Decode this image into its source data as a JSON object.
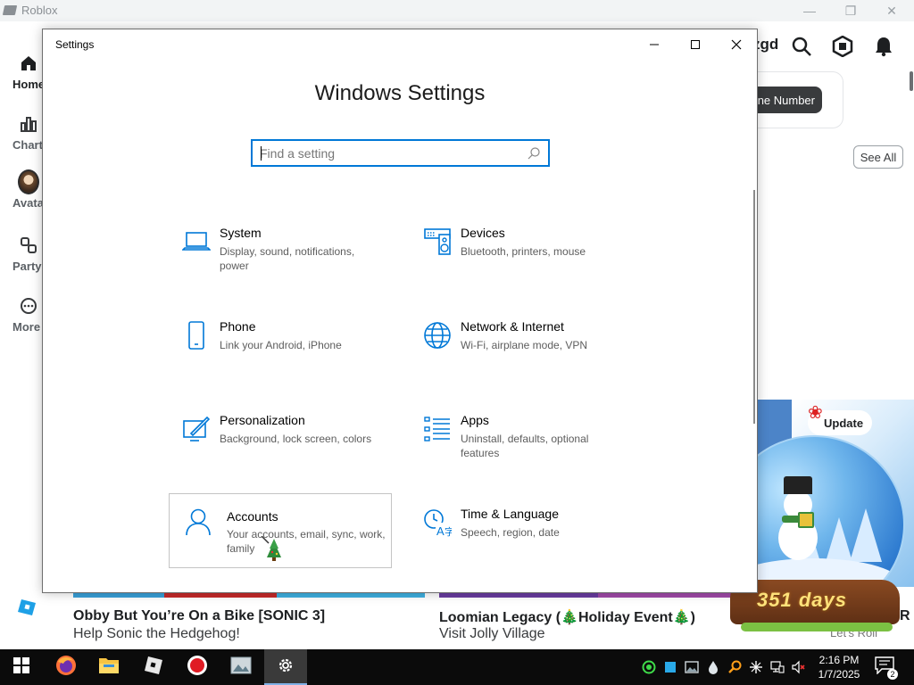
{
  "roblox": {
    "window_title": "Roblox",
    "nav": [
      {
        "label": "Home",
        "icon": "home-icon"
      },
      {
        "label": "Charts",
        "icon": "charts-icon"
      },
      {
        "label": "Avata",
        "icon": "avatar-icon"
      },
      {
        "label": "Party",
        "icon": "party-icon"
      },
      {
        "label": "More",
        "icon": "more-icon"
      }
    ],
    "username_fragment": "zgd",
    "phone_button": "ne Number",
    "see_all": "See All",
    "update_badge": "Update",
    "games": [
      {
        "title": "Obby But You’re On a Bike [SONIC 3]",
        "subtitle": "Help Sonic the Hedgehog!"
      },
      {
        "title": "Loomian Legacy (🎄Holiday Event🎄)",
        "subtitle": "Visit Jolly Village"
      },
      {
        "title": "R",
        "subtitle": "Let's Roll"
      }
    ],
    "countdown": "351 days",
    "colors": {
      "accent_blue": "#0078d7",
      "dark_button": "#393b3d"
    }
  },
  "settings": {
    "window_title": "Settings",
    "heading": "Windows Settings",
    "search_placeholder": "Find a setting",
    "tiles": [
      {
        "name": "System",
        "desc": "Display, sound, notifications, power",
        "icon": "laptop-icon"
      },
      {
        "name": "Devices",
        "desc": "Bluetooth, printers, mouse",
        "icon": "devices-icon"
      },
      {
        "name": "Phone",
        "desc": "Link your Android, iPhone",
        "icon": "phone-icon"
      },
      {
        "name": "Network & Internet",
        "desc": "Wi-Fi, airplane mode, VPN",
        "icon": "globe-icon"
      },
      {
        "name": "Personalization",
        "desc": "Background, lock screen, colors",
        "icon": "paintbrush-icon"
      },
      {
        "name": "Apps",
        "desc": "Uninstall, defaults, optional features",
        "icon": "apps-list-icon"
      },
      {
        "name": "Accounts",
        "desc": "Your accounts, email, sync, work, family",
        "icon": "person-icon"
      },
      {
        "name": "Time & Language",
        "desc": "Speech, region, date",
        "icon": "time-language-icon"
      }
    ]
  },
  "taskbar": {
    "time": "2:16 PM",
    "date": "1/7/2025",
    "notification_count": "2",
    "apps": [
      "start-icon",
      "firefox-icon",
      "file-explorer-icon",
      "roblox-icon",
      "record-icon",
      "photos-icon",
      "settings-gear-icon"
    ]
  }
}
